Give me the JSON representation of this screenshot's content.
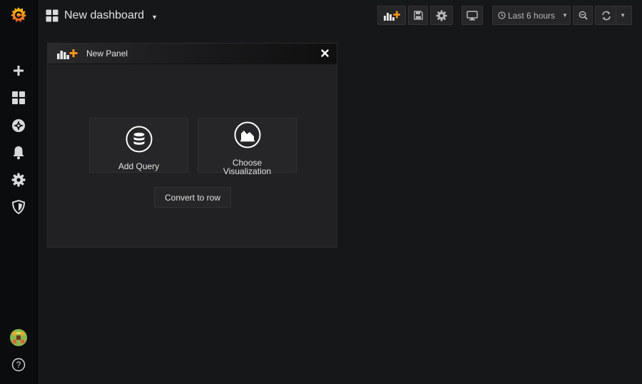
{
  "dashboard": {
    "title": "New dashboard"
  },
  "toolbar": {
    "time_range_label": "Last 6 hours"
  },
  "panel": {
    "title": "New Panel",
    "add_query_label": "Add Query",
    "choose_viz_line1": "Choose",
    "choose_viz_line2": "Visualization",
    "convert_label": "Convert to row"
  },
  "sidebar": {
    "help_label": "?"
  },
  "colors": {
    "brand_orange": "#f7941d",
    "background": "#161719",
    "sidebar": "#0b0c0e",
    "panel": "#212124"
  }
}
